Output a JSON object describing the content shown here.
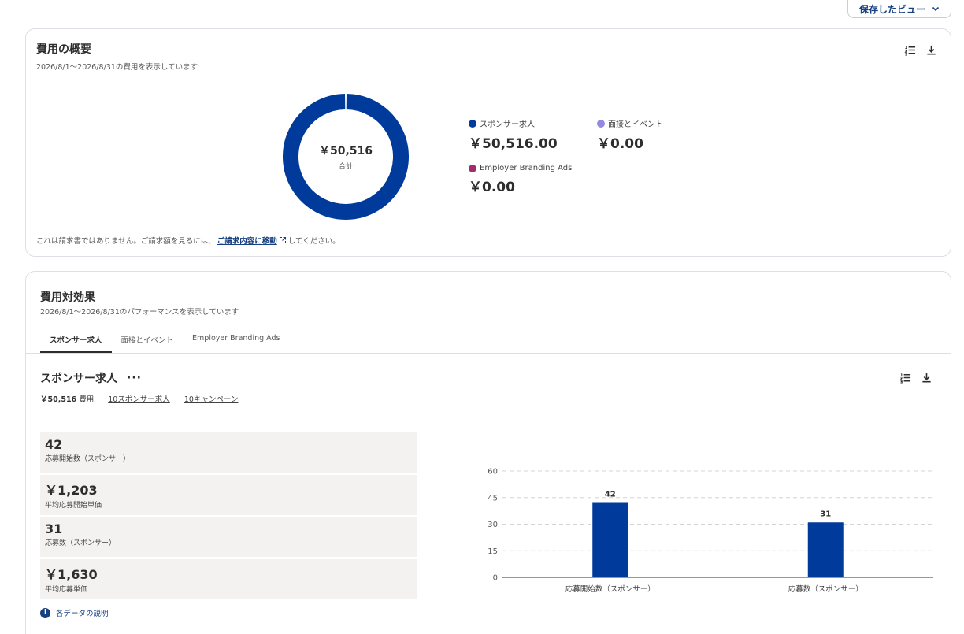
{
  "saved_view": {
    "label": "保存したビュー"
  },
  "overview": {
    "title": "費用の概要",
    "subtitle": "2026/8/1〜2026/8/31の費用を表示しています",
    "total_amount": "￥50,516",
    "total_label": "合計",
    "legend": [
      {
        "name": "スポンサー求人",
        "value": "￥50,516.00",
        "color": "#003a9b",
        "amount": 50516
      },
      {
        "name": "面接とイベント",
        "value": "￥0.00",
        "color": "#9389e0",
        "amount": 0
      },
      {
        "name": "Employer Branding Ads",
        "value": "￥0.00",
        "color": "#a0306b",
        "amount": 0
      }
    ],
    "note_before": "これは請求書ではありません。ご請求額を見るには、",
    "note_link": "ご請求内容に移動",
    "note_after": "してください。"
  },
  "performance": {
    "title": "費用対効果",
    "subtitle": "2026/8/1〜2026/8/31のパフォーマンスを表示しています",
    "tabs": [
      {
        "label": "スポンサー求人",
        "active": true
      },
      {
        "label": "面接とイベント",
        "active": false
      },
      {
        "label": "Employer Branding Ads",
        "active": false
      }
    ],
    "section_title": "スポンサー求人",
    "more": "···",
    "cost_value": "￥50,516",
    "cost_label": "費用",
    "jobs_link": "10スポンサー求人",
    "campaigns_link": "10キャンペーン",
    "stats": [
      {
        "value": "42",
        "label": "応募開始数（スポンサー）"
      },
      {
        "value": "￥1,203",
        "label": "平均応募開始単価"
      },
      {
        "value": "31",
        "label": "応募数（スポンサー）"
      },
      {
        "value": "￥1,630",
        "label": "平均応募単価"
      }
    ],
    "info_label": "各データの説明"
  },
  "chart_data": {
    "type": "bar",
    "categories": [
      "応募開始数（スポンサー）",
      "応募数（スポンサー）"
    ],
    "values": [
      42,
      31
    ],
    "yticks": [
      0,
      15,
      30,
      45,
      60
    ],
    "ylim": [
      0,
      60
    ],
    "grid": true,
    "color": "#003a9b"
  }
}
